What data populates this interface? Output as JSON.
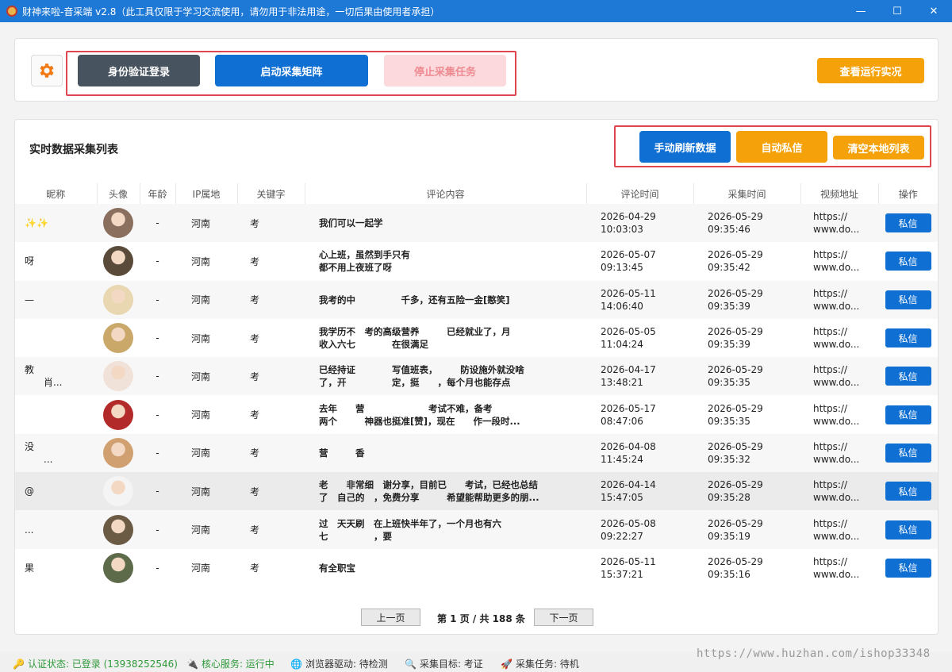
{
  "window": {
    "title": "财神来啦-音采端 v2.8（此工具仅限于学习交流使用，请勿用于非法用途，一切后果由使用者承担）",
    "minimize": "—",
    "maximize": "☐",
    "close": "✕"
  },
  "toolbar": {
    "settings_icon": "gear-icon",
    "login_label": "身份验证登录",
    "start_label": "启动采集矩阵",
    "stop_label": "停止采集任务",
    "status_label": "查看运行实况"
  },
  "list": {
    "title": "实时数据采集列表",
    "refresh_label": "手动刷新数据",
    "auto_dm_label": "自动私信",
    "clear_label": "清空本地列表",
    "columns": [
      "昵称",
      "头像",
      "年龄",
      "IP属地",
      "关键字",
      "评论内容",
      "评论时间",
      "采集时间",
      "视频地址",
      "操作"
    ],
    "rows": [
      {
        "nick": "✨✨",
        "age": "-",
        "ip": "河南",
        "kw": "考",
        "comment": "我们可以一起学",
        "ctime": "2026-04-29\n10:03:03",
        "gtime": "2026-05-29\n09:35:46",
        "url": "https://\nwww.do...",
        "action": "私信",
        "avatar_color": "#8a6f5e"
      },
      {
        "nick": "呀",
        "age": "-",
        "ip": "河南",
        "kw": "考",
        "comment": "心上班，虽然到手只有\n都不用上夜班了呀",
        "ctime": "2026-05-07\n09:13:45",
        "gtime": "2026-05-29\n09:35:42",
        "url": "https://\nwww.do...",
        "action": "私信",
        "avatar_color": "#5a4a3a"
      },
      {
        "nick": "—",
        "age": "-",
        "ip": "河南",
        "kw": "考",
        "comment": "我考的中　　　　　千多，还有五险一金[憨笑]",
        "ctime": "2026-05-11\n14:06:40",
        "gtime": "2026-05-29\n09:35:39",
        "url": "https://\nwww.do...",
        "action": "私信",
        "avatar_color": "#e8d7b0"
      },
      {
        "nick": "",
        "age": "-",
        "ip": "河南",
        "kw": "考",
        "comment": "我学历不　考的高级营养　　　已经就业了，月\n收入六七　　　　在很满足",
        "ctime": "2026-05-05\n11:04:24",
        "gtime": "2026-05-29\n09:35:39",
        "url": "https://\nwww.do...",
        "action": "私信",
        "avatar_color": "#c9a86a"
      },
      {
        "nick": "教\n　　肖...",
        "age": "-",
        "ip": "河南",
        "kw": "考",
        "comment": "已经持证　　　　写值班表，　　　防设施外就没啥\n了，开　　　　　定，挺　　，每个月也能存点",
        "ctime": "2026-04-17\n13:48:21",
        "gtime": "2026-05-29\n09:35:35",
        "url": "https://\nwww.do...",
        "action": "私信",
        "avatar_color": "#f0e2d8"
      },
      {
        "nick": "",
        "age": "-",
        "ip": "河南",
        "kw": "考",
        "comment": "去年　　营　　　　　　　考试不难，备考\n两个　　　神器也挺准[赞]，现在　　作一段时...",
        "ctime": "2026-05-17\n08:47:06",
        "gtime": "2026-05-29\n09:35:35",
        "url": "https://\nwww.do...",
        "action": "私信",
        "avatar_color": "#b32a2a"
      },
      {
        "nick": "没\n　　...",
        "age": "-",
        "ip": "河南",
        "kw": "考",
        "comment": "营　　　香",
        "ctime": "2026-04-08\n11:45:24",
        "gtime": "2026-05-29\n09:35:32",
        "url": "https://\nwww.do...",
        "action": "私信",
        "avatar_color": "#d0a070"
      },
      {
        "nick": "@",
        "age": "-",
        "ip": "河南",
        "kw": "考",
        "comment": "老　　非常细　谢分享，目前已　　考试，已经也总结\n了　自己的　，免费分享　　　希望能帮助更多的朋...",
        "ctime": "2026-04-14\n15:47:05",
        "gtime": "2026-05-29\n09:35:28",
        "url": "https://\nwww.do...",
        "action": "私信",
        "avatar_color": "#f4f4f4"
      },
      {
        "nick": "...",
        "age": "-",
        "ip": "河南",
        "kw": "考",
        "comment": "过　天天刷　在上班快半年了，一个月也有六\n七　　　　　，要",
        "ctime": "2026-05-08\n09:22:27",
        "gtime": "2026-05-29\n09:35:19",
        "url": "https://\nwww.do...",
        "action": "私信",
        "avatar_color": "#6b5a44"
      },
      {
        "nick": "果",
        "age": "-",
        "ip": "河南",
        "kw": "考",
        "comment": "有全职宝",
        "ctime": "2026-05-11\n15:37:21",
        "gtime": "2026-05-29\n09:35:16",
        "url": "https://\nwww.do...",
        "action": "私信",
        "avatar_color": "#5d6b4a"
      }
    ]
  },
  "pager": {
    "prev_label": "上一页",
    "info": "第 1 页 / 共 188 条",
    "next_label": "下一页"
  },
  "status": {
    "auth": "认证状态: 已登录 (13938252546)",
    "core": "核心服务: 运行中",
    "driver": "浏览器驱动: 待检测",
    "target": "采集目标: 考证",
    "task": "采集任务: 待机",
    "watermark": "https://www.huzhan.com/ishop33348"
  }
}
